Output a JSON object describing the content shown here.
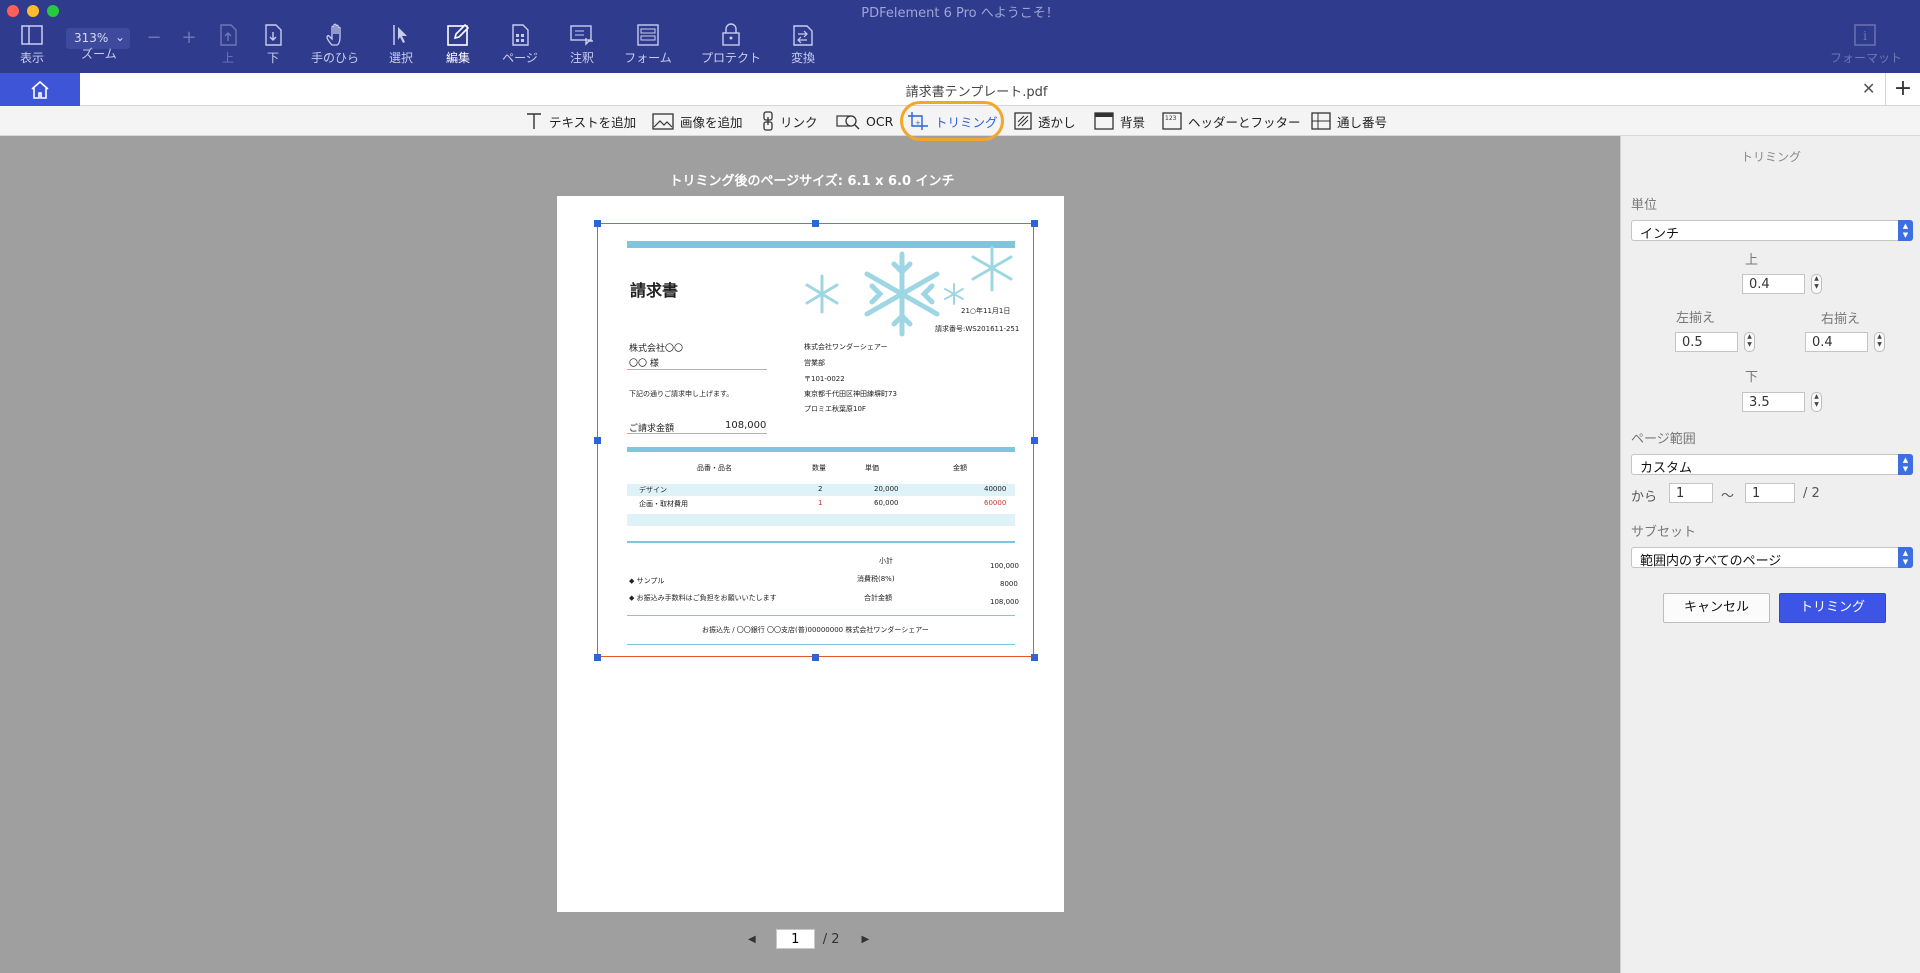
{
  "app": {
    "window_title": "PDFelement 6 Pro へようこそ！",
    "document_tab_title": "請求書テンプレート.pdf"
  },
  "toolbar": {
    "zoom_value": "313%",
    "items": [
      {
        "label": "表示",
        "icon": "sidebar-view-icon"
      },
      {
        "label": "ズーム",
        "icon": "zoom-icon"
      },
      {
        "label": "上",
        "icon": "page-up-icon"
      },
      {
        "label": "下",
        "icon": "page-down-icon"
      },
      {
        "label": "手のひら",
        "icon": "hand-icon"
      },
      {
        "label": "選択",
        "icon": "select-cursor-icon"
      },
      {
        "label": "編集",
        "icon": "edit-pencil-icon"
      },
      {
        "label": "ページ",
        "icon": "page-icon"
      },
      {
        "label": "注釈",
        "icon": "comment-icon"
      },
      {
        "label": "フォーム",
        "icon": "form-icon"
      },
      {
        "label": "プロテクト",
        "icon": "lock-icon"
      },
      {
        "label": "変換",
        "icon": "convert-icon"
      },
      {
        "label": "フォーマット",
        "icon": "info-icon"
      }
    ]
  },
  "edit_tools": [
    {
      "label": "テキストを追加",
      "icon": "text-add-icon"
    },
    {
      "label": "画像を追加",
      "icon": "image-add-icon"
    },
    {
      "label": "リンク",
      "icon": "link-icon"
    },
    {
      "label": "OCR",
      "icon": "ocr-icon"
    },
    {
      "label": "トリミング",
      "icon": "crop-icon"
    },
    {
      "label": "透かし",
      "icon": "watermark-icon"
    },
    {
      "label": "背景",
      "icon": "background-icon"
    },
    {
      "label": "ヘッダーとフッター",
      "icon": "header-footer-icon"
    },
    {
      "label": "通し番号",
      "icon": "bates-number-icon"
    }
  ],
  "document": {
    "size_label": "トリミング後のページサイズ:  6.1 x 6.0   インチ",
    "invoice": {
      "title": "請求書",
      "date": "21○年11月1日",
      "number": "請求番号:WS201611-251",
      "client": "株式会社〇〇",
      "client_person": "〇〇 様",
      "note": "下記の通りご請求申し上げます。",
      "sender_company": "株式会社ワンダーシェアー",
      "sender_dept": "営業部",
      "sender_postal": "〒101-0022",
      "sender_address": "東京都千代田区神田練塀町73",
      "sender_building": "プロミエ秋葉原10F",
      "amount_label": "ご請求金額",
      "amount_value": "108,000",
      "headers": [
        "品番・品名",
        "数量",
        "単価",
        "金額"
      ],
      "rows": [
        {
          "name": "デザイン",
          "qty": "2",
          "price": "20,000",
          "amount": "40000"
        },
        {
          "name": "企画・取材費用",
          "qty": "1",
          "price": "60,000",
          "amount": "60000"
        }
      ],
      "subtotal_label": "小計",
      "subtotal_value": "100,000",
      "tax_label": "消費税(8%)",
      "tax_value": "8000",
      "total_label": "合計金額",
      "total_value": "108,000",
      "note_sample": "サンプル",
      "note_fee": "お振込み手数料はご負担をお願いいたします",
      "bank": "お振込先 / 〇〇銀行  〇〇支店(普)00000000 株式会社ワンダーシェアー"
    }
  },
  "pager": {
    "current": "1",
    "total": "/ 2"
  },
  "panel": {
    "title": "トリミング",
    "unit_label": "単位",
    "unit_value": "インチ",
    "top_label": "上",
    "top_value": "0.4",
    "left_label": "左揃え",
    "left_value": "0.5",
    "right_label": "右揃え",
    "right_value": "0.4",
    "bottom_label": "下",
    "bottom_value": "3.5",
    "range_label": "ページ範囲",
    "range_value": "カスタム",
    "from_label": "から",
    "from_value": "1",
    "tilde": "〜",
    "to_value": "1",
    "of_total": "/ 2",
    "subset_label": "サブセット",
    "subset_value": "範囲内のすべてのページ",
    "cancel_label": "キャンセル",
    "trim_label": "トリミング"
  },
  "colors": {
    "toolbar_bg": "#2f3b8c",
    "accent": "#3d55d6",
    "highlight": "#f1a72b",
    "crop_border": "#e4572e"
  }
}
